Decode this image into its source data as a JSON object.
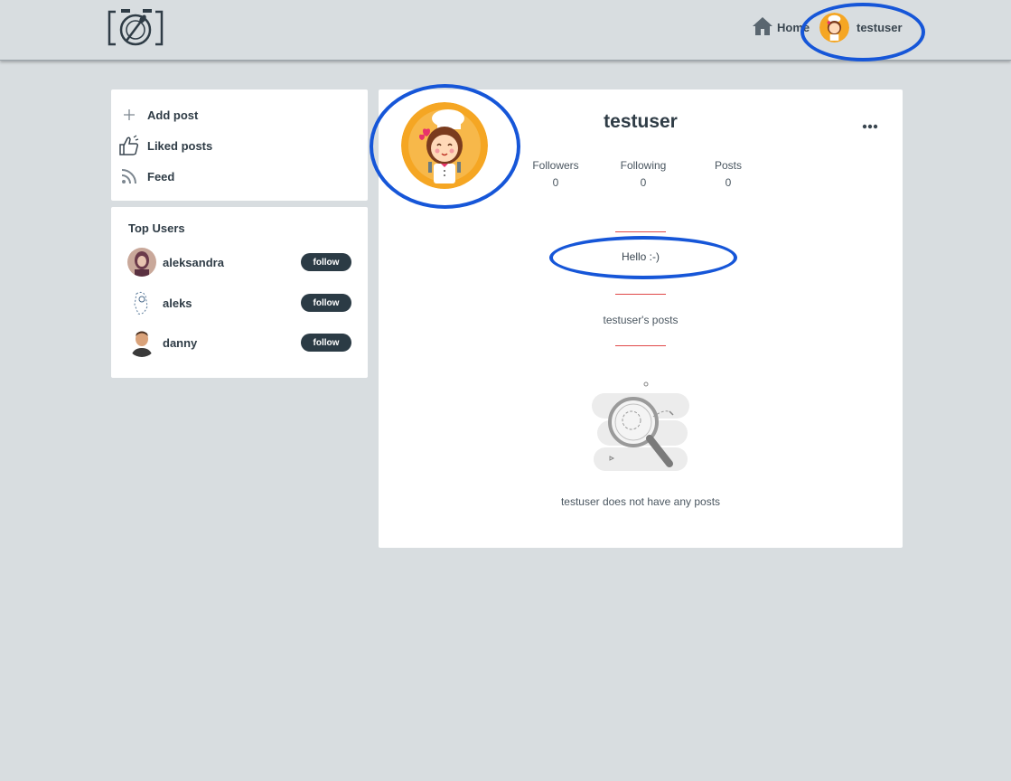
{
  "navbar": {
    "logo_icon": "camera-fork-spoon-logo",
    "home_label": "Home",
    "home_icon": "home-icon",
    "user_label": "testuser"
  },
  "sidebar": {
    "menu": [
      {
        "label": "Add post",
        "icon": "plus-icon"
      },
      {
        "label": "Liked posts",
        "icon": "thumbs-up-icon"
      },
      {
        "label": "Feed",
        "icon": "rss-icon"
      }
    ],
    "top_users": {
      "title": "Top Users",
      "follow_label": "follow",
      "users": [
        {
          "name": "aleksandra"
        },
        {
          "name": "aleks"
        },
        {
          "name": "danny"
        }
      ]
    }
  },
  "profile": {
    "username": "testuser",
    "stats": [
      {
        "label": "Followers",
        "value": "0"
      },
      {
        "label": "Following",
        "value": "0"
      },
      {
        "label": "Posts",
        "value": "0"
      }
    ],
    "bio": "Hello :-)",
    "posts_title": "testuser's posts",
    "empty_message": "testuser does not have any posts"
  },
  "colors": {
    "background": "#d8dde0",
    "card": "#ffffff",
    "button": "#2b3b45",
    "divider": "#e04848",
    "annotation": "#1656d8",
    "avatar_bg": "#f5a623"
  }
}
